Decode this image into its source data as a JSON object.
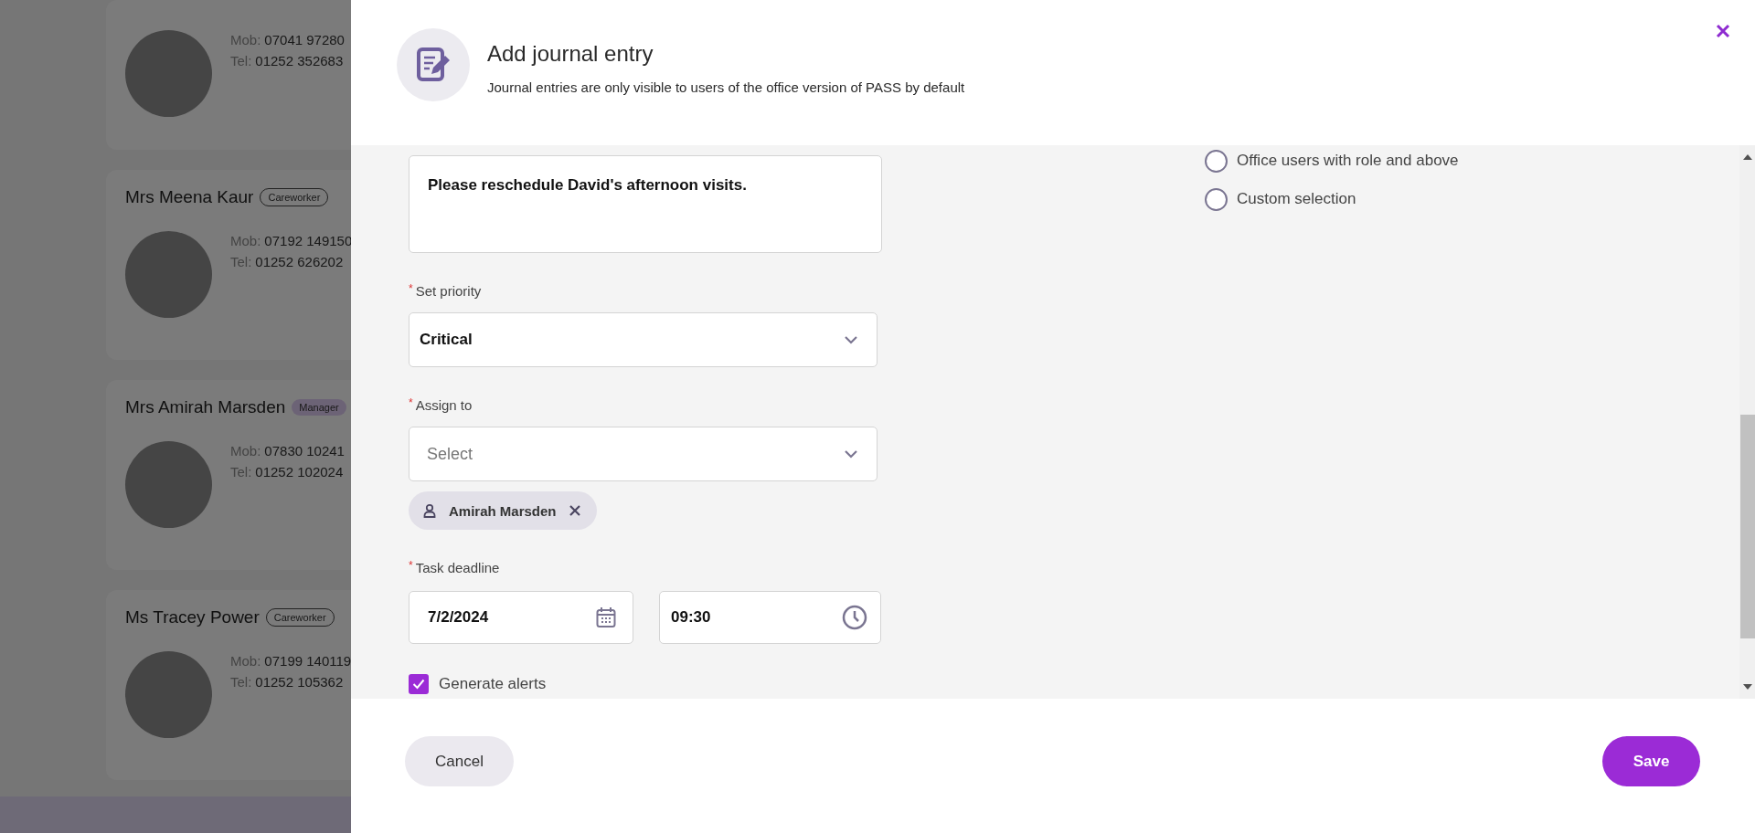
{
  "background_page": {
    "staff_cards": [
      {
        "mob_label": "Mob:",
        "mob": "07041 97280",
        "tel_label": "Tel:",
        "tel": "01252 352683"
      },
      {
        "name": "Mrs Meena Kaur",
        "role": "Careworker",
        "kind": "outlined",
        "mob_label": "Mob:",
        "mob": "07192 149150",
        "tel_label": "Tel:",
        "tel": "01252 626202"
      },
      {
        "name": "Mrs Amirah Marsden",
        "role": "Manager",
        "kind": "filled",
        "mob_label": "Mob:",
        "mob": "07830 10241",
        "tel_label": "Tel:",
        "tel": "01252 102024"
      },
      {
        "name": "Ms Tracey Power",
        "role": "Careworker",
        "kind": "outlined",
        "mob_label": "Mob:",
        "mob": "07199 140119",
        "tel_label": "Tel:",
        "tel": "01252 105362"
      }
    ]
  },
  "dialog": {
    "title": "Add journal entry",
    "subtitle": "Journal entries are only visible to users of the office version of PASS by default",
    "message": {
      "value": "Please reschedule David's afternoon visits."
    },
    "priority": {
      "required_mark": "*",
      "label": "Set priority",
      "value": "Critical"
    },
    "assign_to": {
      "required_mark": "*",
      "label": "Assign to",
      "placeholder": "Select",
      "chips": [
        {
          "label": "Amirah Marsden"
        }
      ]
    },
    "task_deadline": {
      "required_mark": "*",
      "label": "Task deadline",
      "date": "7/2/2024",
      "time": "09:30"
    },
    "generate_alerts": {
      "label": "Generate alerts",
      "checked": true
    },
    "visibility_options": [
      {
        "label": "Office users with role and above",
        "selected": false
      },
      {
        "label": "Custom selection",
        "selected": false
      }
    ],
    "buttons": [
      {
        "label": "Cancel",
        "kind": "secondary"
      },
      {
        "label": "Save",
        "kind": "primary"
      }
    ]
  }
}
